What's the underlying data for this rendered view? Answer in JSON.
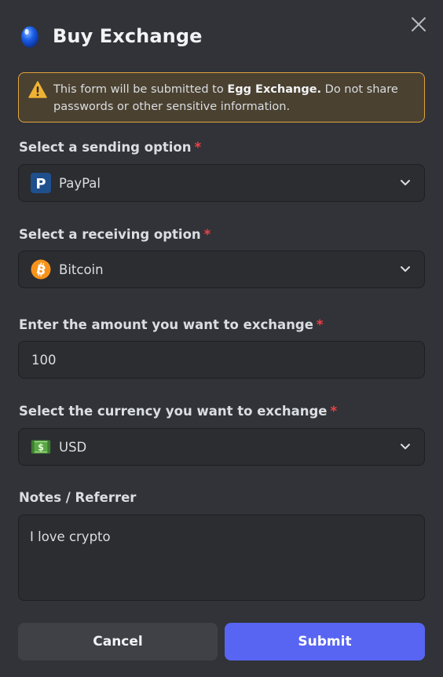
{
  "header": {
    "title": "Buy Exchange",
    "icon": "blue-egg-icon"
  },
  "warning": {
    "text_before": "This form will be submitted to ",
    "bold": "Egg Exchange.",
    "text_after": " Do not share passwords or other sensitive information.",
    "color": "#e2a33a"
  },
  "form": {
    "required_marker": "*",
    "sending": {
      "label": "Select a sending option",
      "value": "PayPal",
      "icon": "paypal-icon"
    },
    "receiving": {
      "label": "Select a receiving option",
      "value": "Bitcoin",
      "icon": "bitcoin-icon"
    },
    "amount": {
      "label": "Enter the amount you want to exchange",
      "value": "100"
    },
    "currency": {
      "label": "Select the currency you want to exchange",
      "value": "USD",
      "icon": "dollar-banknote-icon"
    },
    "notes": {
      "label": "Notes / Referrer",
      "value": "I love crypto"
    }
  },
  "buttons": {
    "cancel": "Cancel",
    "submit": "Submit"
  },
  "colors": {
    "background": "#313338",
    "field": "#2b2d31",
    "accent": "#5865f2",
    "required": "#f23f43"
  }
}
